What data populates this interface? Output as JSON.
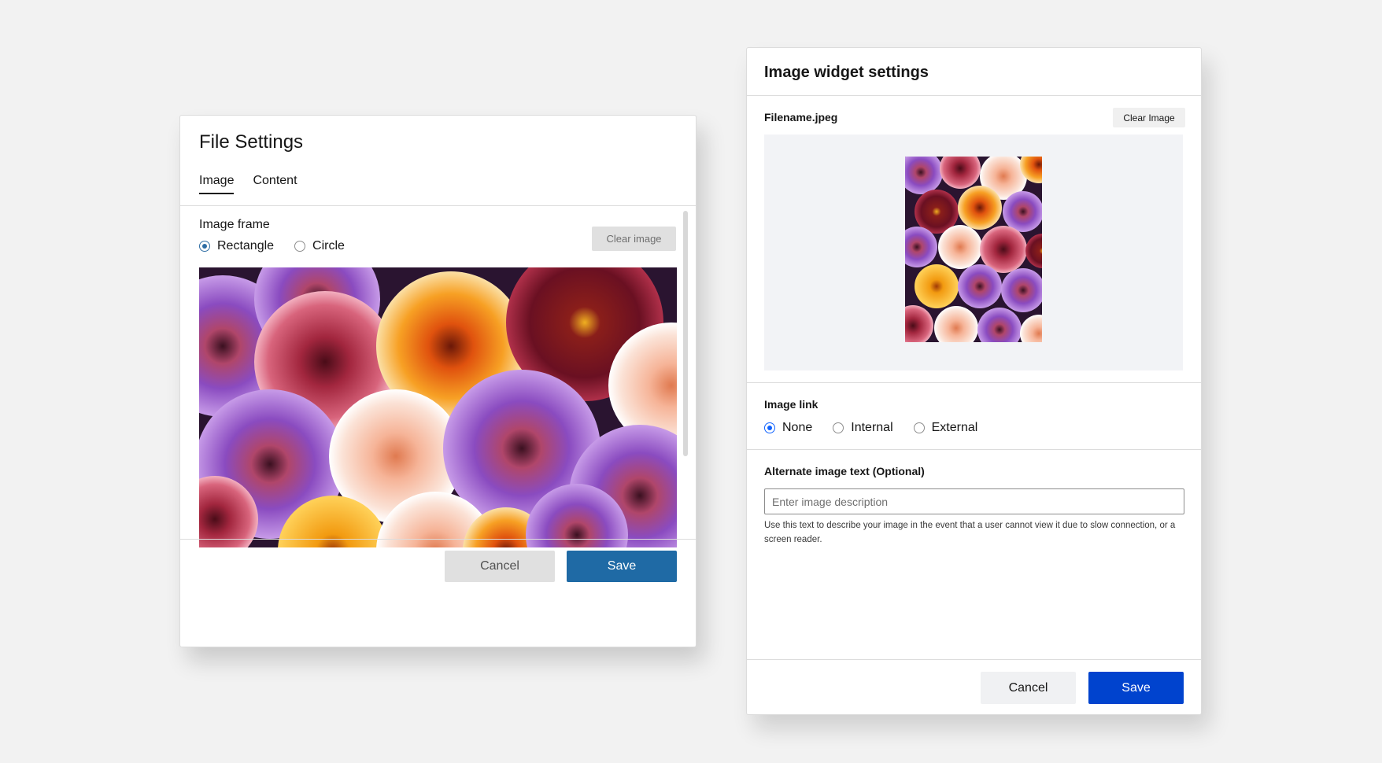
{
  "file_settings": {
    "title": "File Settings",
    "tabs": [
      {
        "label": "Image",
        "active": true
      },
      {
        "label": "Content",
        "active": false
      }
    ],
    "image_frame_label": "Image frame",
    "frame_options": [
      {
        "label": "Rectangle",
        "checked": true
      },
      {
        "label": "Circle",
        "checked": false
      }
    ],
    "clear_label": "Clear image",
    "cancel_label": "Cancel",
    "save_label": "Save",
    "save_color": "#1f6aa5"
  },
  "image_widget": {
    "title": "Image widget settings",
    "filename": "Filename.jpeg",
    "clear_label": "Clear Image",
    "image_link_label": "Image link",
    "link_options": [
      {
        "label": "None",
        "checked": true
      },
      {
        "label": "Internal",
        "checked": false
      },
      {
        "label": "External",
        "checked": false
      }
    ],
    "alt_label": "Alternate image text (Optional)",
    "alt_placeholder": "Enter image description",
    "alt_value": "",
    "helper_text": "Use this text to describe your image in the event that a user cannot view it due to slow connection, or a screen reader.",
    "cancel_label": "Cancel",
    "save_label": "Save",
    "save_color": "#0043ce"
  }
}
